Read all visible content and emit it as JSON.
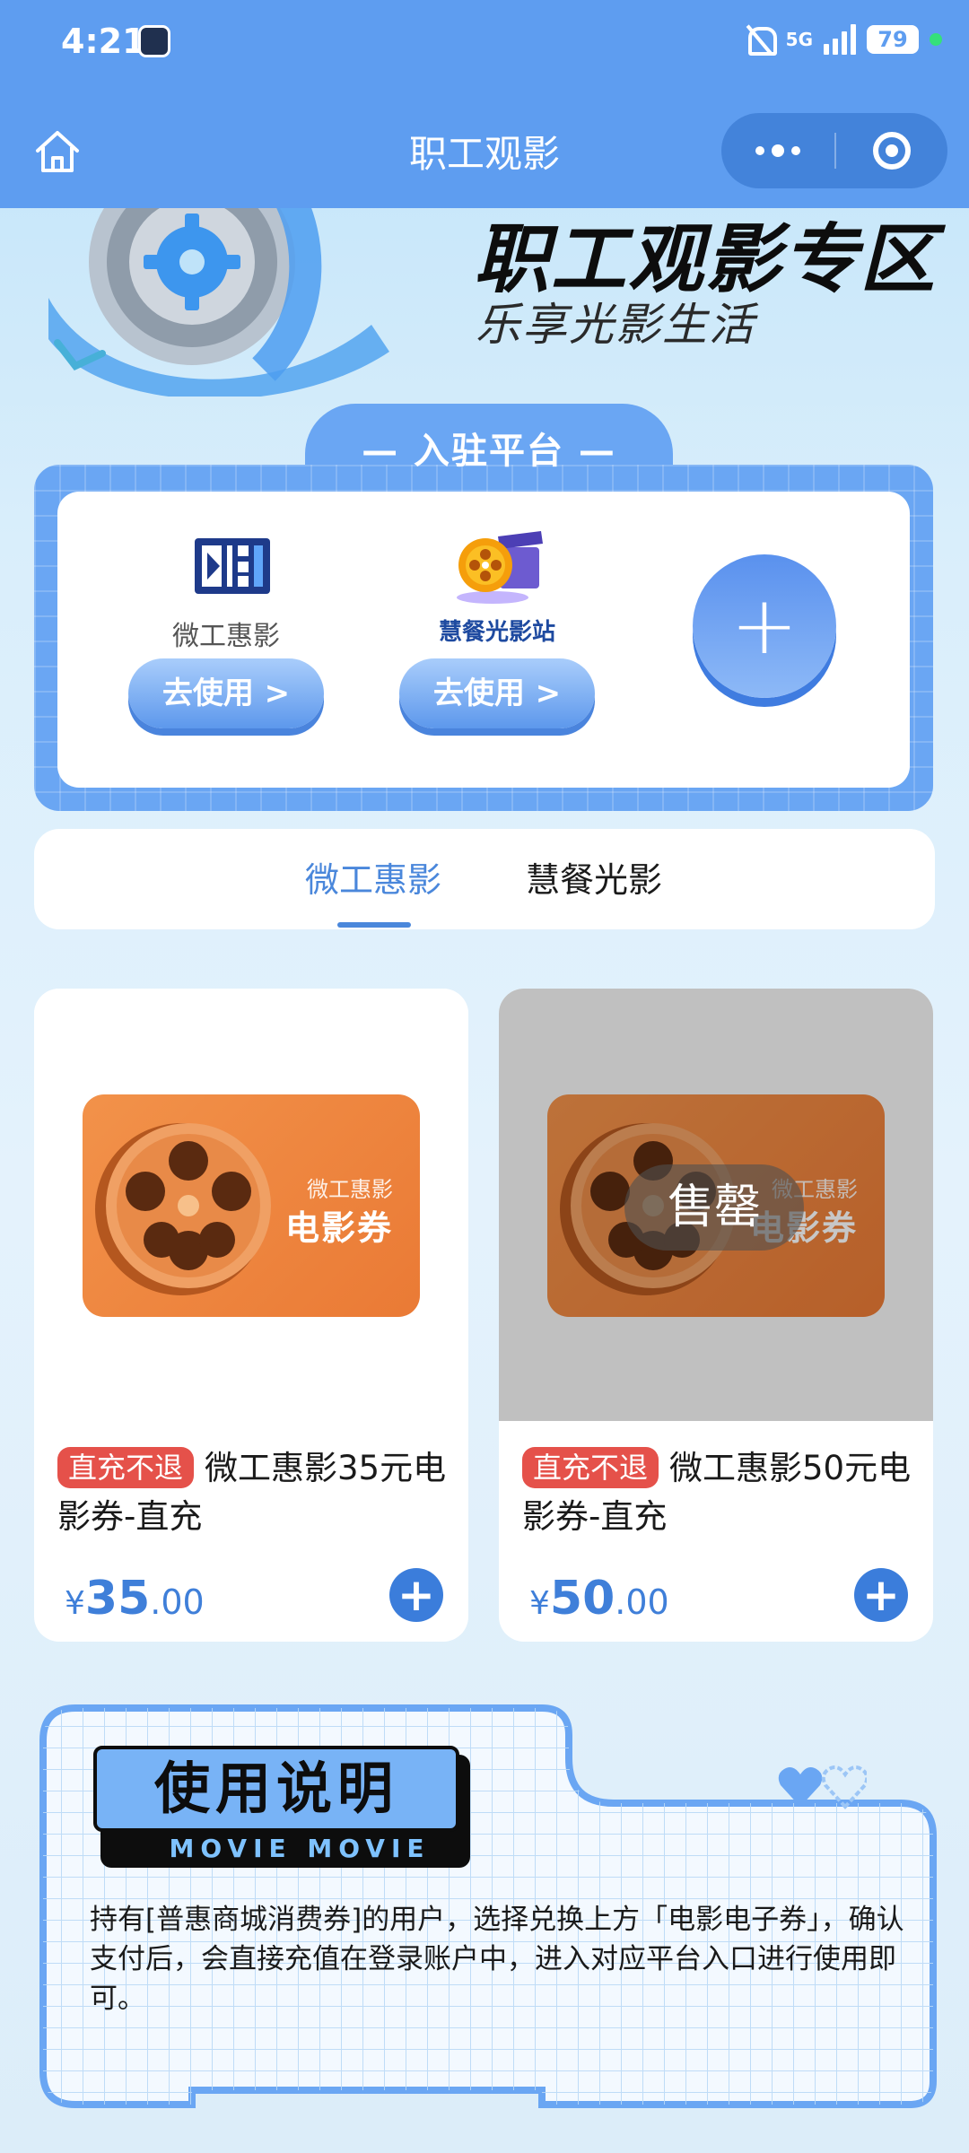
{
  "status_bar": {
    "time": "4:21",
    "network": "5G",
    "battery": "79"
  },
  "nav": {
    "title": "职工观影"
  },
  "hero": {
    "title": "职工观影专区",
    "subtitle": "乐享光影生活"
  },
  "platforms": {
    "title": "— 入驻平台 —",
    "items": [
      {
        "name": "微工惠影",
        "button": "去使用 >"
      },
      {
        "name": "慧餐光影站",
        "button": "去使用 >"
      }
    ],
    "add_label": "+"
  },
  "tabs": [
    {
      "label": "微工惠影",
      "active": true
    },
    {
      "label": "慧餐光影",
      "active": false
    }
  ],
  "products": [
    {
      "tag": "直充不退",
      "name": "微工惠影35元电影券-直充",
      "currency": "¥",
      "price_int": "35",
      "price_dec": ".00",
      "voucher_brand": "微工惠影",
      "voucher_title": "电影券",
      "sold_out": false
    },
    {
      "tag": "直充不退",
      "name": "微工惠影50元电影券-直充",
      "currency": "¥",
      "price_int": "50",
      "price_dec": ".00",
      "voucher_brand": "微工惠影",
      "voucher_title": "电影券",
      "sold_out": true,
      "sold_out_label": "售罄"
    }
  ],
  "instructions": {
    "title": "使用说明",
    "title_en": "MOVIE MOVIE",
    "text": "持有[普惠商城消费券]的用户，选择兑换上方「电影电子券」，确认支付后，会直接充值在登录账户中，进入对应平台入口进行使用即可。"
  },
  "colors": {
    "nav_bg": "#5e9df0",
    "accent": "#4a87db",
    "tag_red": "#e5514a",
    "voucher_orange": "#ea7a35"
  }
}
